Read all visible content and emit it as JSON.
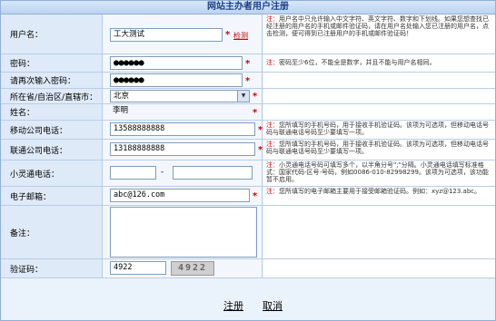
{
  "title": "网站主办者用户注册",
  "username": {
    "label": "用户名：",
    "value": "工大测试",
    "check_link": "检测",
    "tip_prefix": "注：",
    "tip": "用户名中只允许输入中文字符、英文字符、数字和下划线。如果您想查找已经注册的用户名的手机或邮件验证码，请在用户名处输入您已注册的用户名，点击检测，便可得到已注册用户的手机或邮件验证码！"
  },
  "password": {
    "label": "密码：",
    "value": "●●●●●●",
    "tip_prefix": "注：",
    "tip": "密码至少6位，不能全是数字，并且不能与用户名相同。"
  },
  "password_confirm": {
    "label": "请再次输入密码：",
    "value": "●●●●●●"
  },
  "region": {
    "label": "所在省/自治区/直辖市：",
    "value": "北京"
  },
  "name": {
    "label": "姓名：",
    "value": "李明"
  },
  "mobile": {
    "label": "移动公司电话：",
    "value": "13588888888",
    "tip_prefix": "注：",
    "tip": "您所填写的手机号码，用于接收手机验证码。该项为可选项，但移动电话号码与联通电话号码至少要填写一项。"
  },
  "unicom": {
    "label": "联通公司电话：",
    "value": "13188888888",
    "tip_prefix": "注：",
    "tip": "您所填写的手机号码，用于接收手机验证码。该项为可选项，但移动电话号码与联通电话号码至少要填写一项。"
  },
  "phs": {
    "label": "小灵通电话：",
    "separator": "-",
    "value_area": "",
    "value_number": "",
    "tip_prefix": "注：",
    "tip": "小灵通电话号码可填写多个，以半角分号\";\"分隔。小灵通电话填写标准格式：国家代码-区号-号码，例如0086-010-82998299。该项为可选项，该功能暂不启用。"
  },
  "email": {
    "label": "电子邮箱：",
    "value": "abc@126.com",
    "tip_prefix": "注：",
    "tip": "您所填写的电子邮箱主要用于接受邮箱验证码。例如：xyz@123.abc。"
  },
  "remark": {
    "label": "备注：",
    "value": ""
  },
  "captcha": {
    "label": "验证码：",
    "value": "4922",
    "image_text": "4922"
  },
  "buttons": {
    "submit": "注册",
    "cancel": "取消"
  },
  "colors": {
    "title_text": "#1b3d8a",
    "required_star": "#d20000",
    "note_prefix": "#d20000",
    "border": "#8fb0d6"
  }
}
